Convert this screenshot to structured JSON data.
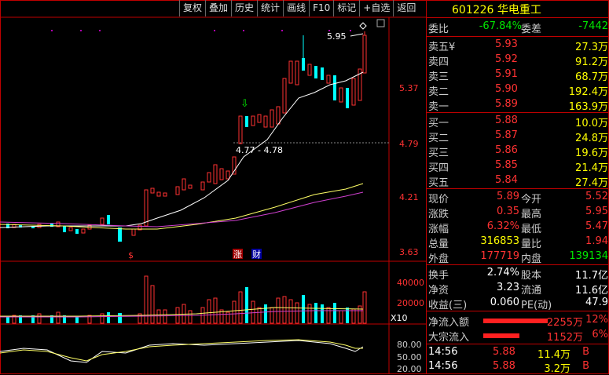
{
  "toolbar": {
    "items": [
      "复权",
      "叠加",
      "历史",
      "统计",
      "画线",
      "F10",
      "标记",
      "+自选",
      "返回"
    ]
  },
  "chart": {
    "price_axis": [
      "5.37",
      "4.79",
      "4.21",
      "3.63"
    ],
    "volume_axis": [
      "40000",
      "20000",
      "X10"
    ],
    "indicator_axis": [
      "80.00",
      "50.00",
      "20.00"
    ],
    "high_label": "5.95",
    "range_label": "4.77 - 4.78",
    "markers": {
      "s": "$",
      "zhang": "涨",
      "cai": "财"
    }
  },
  "quote": {
    "code": "601226",
    "name": "华电重工",
    "weibi_label": "委比",
    "weibi_value": "-67.84%",
    "weicha_label": "委差",
    "weicha_value": "-7442",
    "sells": [
      {
        "label": "卖五",
        "mark": "¥",
        "price": "5.93",
        "vol": "27.3万"
      },
      {
        "label": "卖四",
        "mark": "",
        "price": "5.92",
        "vol": "91.2万"
      },
      {
        "label": "卖三",
        "mark": "",
        "price": "5.91",
        "vol": "68.7万"
      },
      {
        "label": "卖二",
        "mark": "",
        "price": "5.90",
        "vol": "192.4万"
      },
      {
        "label": "卖一",
        "mark": "",
        "price": "5.89",
        "vol": "163.9万"
      }
    ],
    "buys": [
      {
        "label": "买一",
        "price": "5.88",
        "vol": "10.0万"
      },
      {
        "label": "买二",
        "price": "5.87",
        "vol": "24.8万"
      },
      {
        "label": "买三",
        "price": "5.86",
        "vol": "19.6万"
      },
      {
        "label": "买四",
        "price": "5.85",
        "vol": "21.4万"
      },
      {
        "label": "买五",
        "price": "5.84",
        "vol": "27.4万"
      }
    ],
    "stats": [
      {
        "l1": "现价",
        "v1": "5.89",
        "c1": "red",
        "l2": "今开",
        "v2": "5.52",
        "c2": "red"
      },
      {
        "l1": "涨跌",
        "v1": "0.35",
        "c1": "red",
        "l2": "最高",
        "v2": "5.95",
        "c2": "red"
      },
      {
        "l1": "涨幅",
        "v1": "6.32%",
        "c1": "red",
        "l2": "最低",
        "v2": "5.47",
        "c2": "red"
      },
      {
        "l1": "总量",
        "v1": "316853",
        "c1": "yellow",
        "l2": "量比",
        "v2": "1.94",
        "c2": "red"
      },
      {
        "l1": "外盘",
        "v1": "177719",
        "c1": "red",
        "l2": "内盘",
        "v2": "139134",
        "c2": "green"
      }
    ],
    "stats2": [
      {
        "l1": "换手",
        "v1": "2.74%",
        "l2": "股本",
        "v2": "11.7亿"
      },
      {
        "l1": "净资",
        "v1": "3.23",
        "l2": "流通",
        "v2": "11.6亿"
      },
      {
        "l1": "收益(三)",
        "v1": "0.060",
        "l2": "PE(动)",
        "v2": "47.9"
      }
    ],
    "flows": [
      {
        "label": "净流入额",
        "value": "2255万",
        "pct": "12%"
      },
      {
        "label": "大宗流入",
        "value": "1152万",
        "pct": "6%"
      }
    ],
    "ticks": [
      {
        "time": "14:56",
        "price": "5.88",
        "vol": "11.4万",
        "side": "B"
      },
      {
        "time": "14:56",
        "price": "5.88",
        "vol": "3.2万",
        "side": "B"
      }
    ]
  }
}
